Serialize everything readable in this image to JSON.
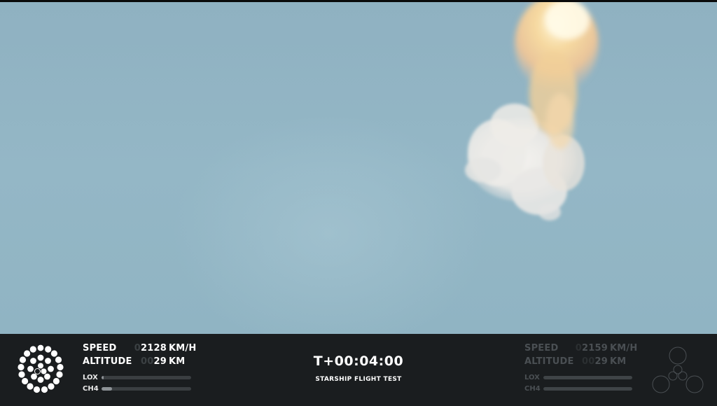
{
  "booster": {
    "speed_label": "SPEED",
    "speed_value": "2128",
    "speed_unit": "KM/H",
    "altitude_label": "ALTITUDE",
    "altitude_value": "29",
    "altitude_unit": "KM",
    "lox_label": "LOX",
    "lox_level": 0.02,
    "ch4_label": "CH4",
    "ch4_level": 0.12
  },
  "clock": "T+00:04:00",
  "mission": "STARSHIP FLIGHT TEST",
  "ship": {
    "speed_label": "SPEED",
    "speed_value": "2159",
    "speed_unit": "KM/H",
    "altitude_label": "ALTITUDE",
    "altitude_value": "29",
    "altitude_unit": "KM",
    "lox_label": "LOX",
    "lox_level": 1.0,
    "ch4_label": "CH4",
    "ch4_level": 1.0
  },
  "icons": {
    "left": "super-heavy-engines-icon",
    "right": "starship-engines-icon"
  },
  "colors": {
    "sky": "#94b7c6",
    "hud_background": "#1a1d1f",
    "text": "#ffffff",
    "dimmed_text": "#4a4f53"
  }
}
